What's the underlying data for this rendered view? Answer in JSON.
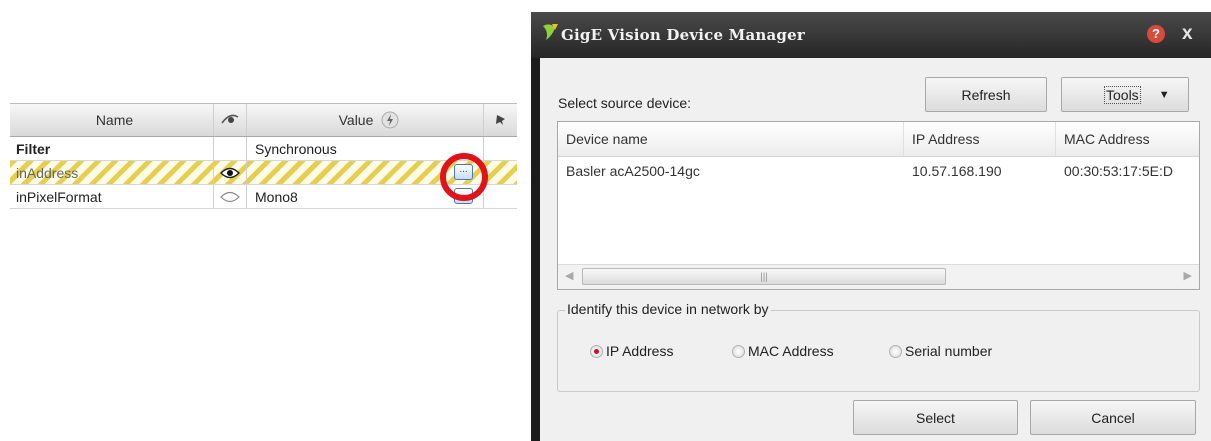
{
  "grid": {
    "headers": {
      "name": "Name",
      "value": "Value",
      "value_icon": "lightning-icon",
      "visibility_icon": "eye-icon",
      "pin_icon": "pin-icon"
    },
    "rows": [
      {
        "name": "Filter",
        "visibility": "",
        "value": "Synchronous",
        "has_button": false
      },
      {
        "name": "inAddress",
        "visibility": "eye-visible-icon",
        "value": "",
        "has_button": true,
        "selected": true
      },
      {
        "name": "inPixelFormat",
        "visibility": "eye-hidden-icon",
        "value": "Mono8",
        "has_button": true
      }
    ],
    "ellipsis": "...",
    "highlight_color": "#e0121a"
  },
  "dialog": {
    "title": "GigE Vision Device Manager",
    "help_glyph": "?",
    "close_glyph": "x",
    "select_source_label": "Select source device:",
    "refresh_label": "Refresh",
    "tools_label": "Tools",
    "columns": [
      "Device name",
      "IP Address",
      "MAC Address"
    ],
    "devices": [
      {
        "name": "Basler acA2500-14gc",
        "ip": "10.57.168.190",
        "mac": "00:30:53:17:5E:D"
      }
    ],
    "identify_legend": "Identify this device in network by",
    "radio_options": [
      {
        "label": "IP Address",
        "selected": true
      },
      {
        "label": "MAC Address",
        "selected": false
      },
      {
        "label": "Serial number",
        "selected": false
      }
    ],
    "select_label": "Select",
    "cancel_label": "Cancel"
  }
}
